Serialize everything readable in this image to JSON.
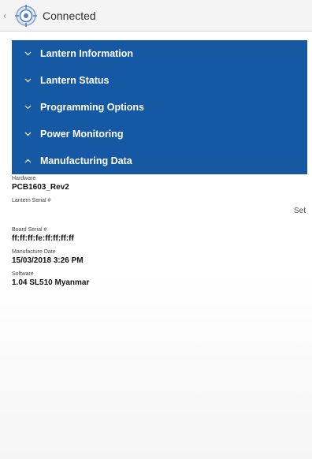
{
  "topbar": {
    "back_icon": "chevron-left-icon",
    "logo_icon": "target-compass-icon",
    "title": "Connected"
  },
  "accordion": {
    "color": "#1558a3",
    "items": [
      {
        "label": "Lantern Information",
        "expanded": false
      },
      {
        "label": "Lantern Status",
        "expanded": false
      },
      {
        "label": "Programming Options",
        "expanded": false
      },
      {
        "label": "Power Monitoring",
        "expanded": false
      },
      {
        "label": "Manufacturing Data",
        "expanded": true
      }
    ]
  },
  "manufacturing": {
    "hardware_label": "Hardware",
    "hardware_value": "PCB1603_Rev2",
    "lantern_serial_label": "Lantern Serial #",
    "lantern_serial_value": "",
    "set_label": "Set",
    "board_serial_label": "Board Serial #",
    "board_serial_value": "ff:ff:ff:fe:ff:ff:ff:ff",
    "manufacture_date_label": "Manufacture Date",
    "manufacture_date_value": "15/03/2018 3:26 PM",
    "software_label": "Software",
    "software_value": "1.04 SL510 Myanmar"
  }
}
